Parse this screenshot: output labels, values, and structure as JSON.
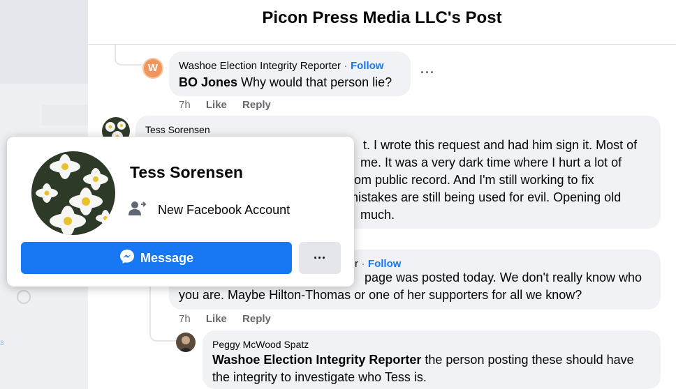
{
  "post_title": "Picon Press Media LLC's Post",
  "comments": [
    {
      "author": "Washoe Election Integrity Reporter",
      "follow": "Follow",
      "separator": "·",
      "mention": "BO Jones",
      "text": " Why would that person lie?",
      "time": "7h",
      "like": "Like",
      "reply": "Reply",
      "avatar_letter": "W"
    },
    {
      "author": "Tess Sorensen",
      "lines": [
        "t. I wrote this request and had him sign it. Most of",
        "me. It was a very dark time where I hurt a lot of",
        "from public record. And I'm still working to fix",
        "mistakes are still being used for evil. Opening old",
        "much."
      ]
    },
    {
      "follow_fragment": "r",
      "separator": "·",
      "follow": "Follow",
      "lines": [
        "page was posted today. We don't really know who",
        "you are. Maybe Hilton-Thomas or one of her supporters for all we know?"
      ],
      "time": "7h",
      "like": "Like",
      "reply": "Reply"
    },
    {
      "author": "Peggy McWood Spatz",
      "mention": "Washoe Election Integrity Reporter",
      "text": " the person posting these should have",
      "line2": "the integrity to investigate who Tess is."
    }
  ],
  "more_dots": "···",
  "hover_card": {
    "name": "Tess Sorensen",
    "subtitle": "New Facebook Account",
    "message_button": "Message",
    "more_button": "···"
  },
  "colors": {
    "accent": "#1877f2",
    "avatar_w": "#f0955b"
  },
  "icons": [
    "messenger-icon",
    "person-arrow-icon",
    "more-icon"
  ]
}
